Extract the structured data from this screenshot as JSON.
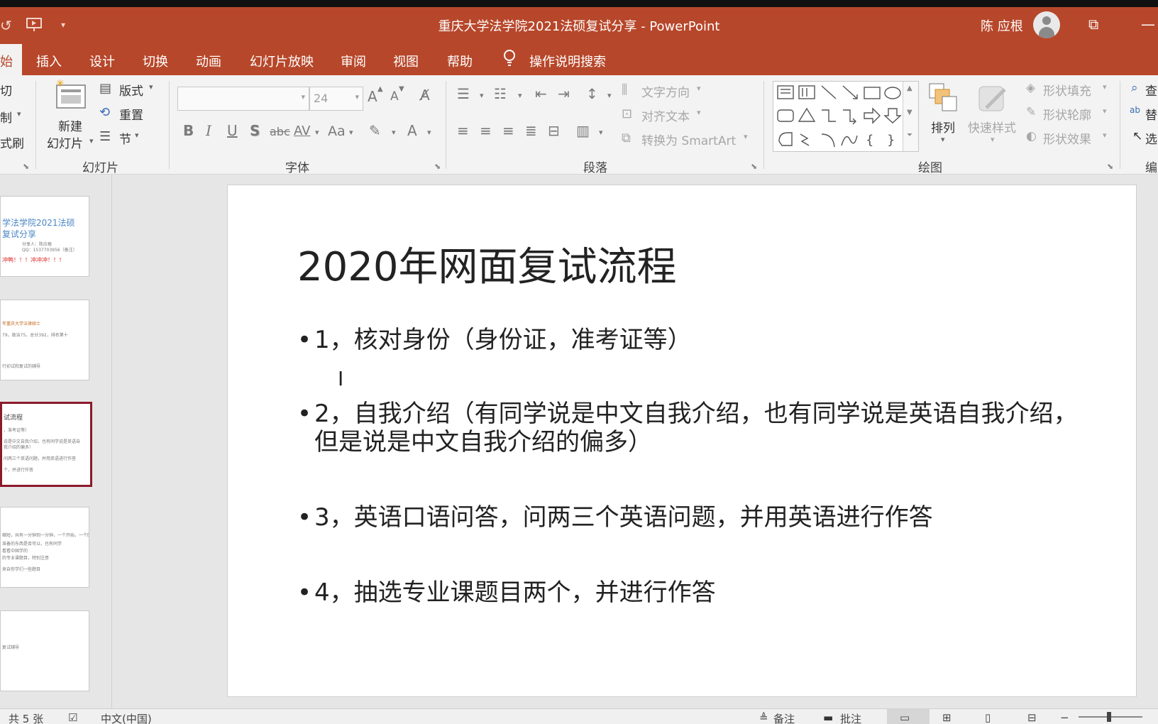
{
  "window": {
    "title": "重庆大学法学院2021法硕复试分享 - PowerPoint",
    "user_name": "陈 应根"
  },
  "quick_access": {
    "undo_icon": "undo-icon",
    "present_icon": "present-from-start-icon",
    "customize_icon": "customize-qat-icon"
  },
  "tabs": {
    "active_partial": "始",
    "items": [
      "插入",
      "设计",
      "切换",
      "动画",
      "幻灯片放映",
      "审阅",
      "视图",
      "帮助"
    ],
    "tell_me": "操作说明搜索"
  },
  "ribbon": {
    "clipboard": {
      "cut": "切",
      "copy": "制",
      "format_painter": "式刷"
    },
    "slides": {
      "new_slide_line1": "新建",
      "new_slide_line2": "幻灯片",
      "layout": "版式",
      "reset": "重置",
      "section": "节",
      "group_label": "幻灯片"
    },
    "font": {
      "font_name": "",
      "font_size": "24",
      "bold": "B",
      "italic": "I",
      "underline": "U",
      "shadow": "S",
      "strikethrough": "abc",
      "spacing": "AV",
      "change_case": "Aa",
      "grow": "A",
      "shrink": "A",
      "font_color": "A",
      "group_label": "字体"
    },
    "paragraph": {
      "text_direction": "文字方向",
      "align_text": "对齐文本",
      "smartart": "转换为 SmartArt",
      "group_label": "段落"
    },
    "drawing": {
      "arrange": "排列",
      "quick_styles": "快速样式",
      "shape_fill": "形状填充",
      "shape_outline": "形状轮廓",
      "shape_effects": "形状效果",
      "group_label": "绘图"
    },
    "editing": {
      "find": "查",
      "replace": "替",
      "select": "选",
      "group_label": "编"
    }
  },
  "thumbnails": [
    {
      "line1": "学法学院2021法硕",
      "line2": "复试分享",
      "line3": "分享人：陈应根",
      "line4": "QQ：1537703956（备注）",
      "line5": "冲鸭！！！冲冲冲！！！"
    },
    {
      "line1": "年重庆大学法律硕士",
      "line2": "79，政治75，总分392，排名第十",
      "line3": "行初试和复试的辅导"
    },
    {
      "line1": "试流程",
      "line2": "，准考证等）",
      "line3": "说是中文自我介绍，也有同学说是英语自",
      "line4": "我介绍的偏多）",
      "line5": "问两三个英语问题，并用英语进行作答",
      "line6": "个，并进行作答"
    },
    {
      "line1": "缩短，共有一分钟到一分钟，一个开始，一个回顾",
      "line2": "准备的东西是否可以，也有同学",
      "line3": "看看中国学的",
      "line4": "的专业课题目，特别注意",
      "line5": "来自你学们一些题目"
    },
    {
      "line1": "复试辅导"
    }
  ],
  "slide": {
    "title": "2020年网面复试流程",
    "bullet_char": "•",
    "bullets": [
      "1，核对身份（身份证，准考证等）",
      "2，自我介绍（有同学说是中文自我介绍，也有同学说是英语自我介绍，但是说是中文自我介绍的偏多）",
      "3，英语口语问答，问两三个英语问题，并用英语进行作答",
      "4，抽选专业课题目两个，并进行作答"
    ]
  },
  "status": {
    "slide_count": "共 5 张",
    "language": "中文(中国)",
    "notes": "备注",
    "comments": "批注"
  },
  "colors": {
    "accent": "#b7472a",
    "selected_thumb_border": "#8b1a2b"
  }
}
